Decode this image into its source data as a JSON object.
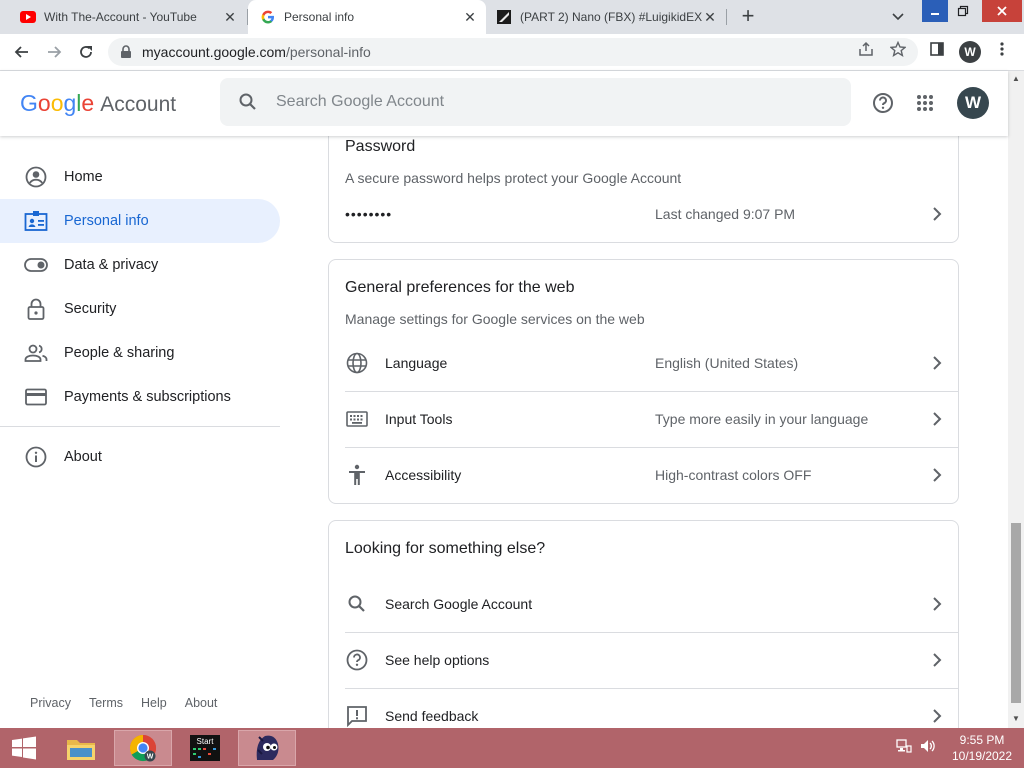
{
  "browser": {
    "tabs": [
      {
        "title": "With The-Account - YouTube",
        "active": false,
        "favicon": "youtube-icon"
      },
      {
        "title": "Personal info",
        "active": true,
        "favicon": "google-g-icon"
      },
      {
        "title": "(PART 2) Nano (FBX) #LuigikidEX",
        "active": false,
        "favicon": "deviantart-icon"
      }
    ],
    "url_host": "myaccount.google.com",
    "url_path": "/personal-info",
    "profile_initial": "W"
  },
  "header": {
    "logo_google": "Google",
    "logo_account": "Account",
    "search_placeholder": "Search Google Account",
    "avatar_initial": "W"
  },
  "sidebar": {
    "items": [
      {
        "label": "Home",
        "icon": "account-circle-icon"
      },
      {
        "label": "Personal info",
        "icon": "id-card-icon",
        "active": true
      },
      {
        "label": "Data & privacy",
        "icon": "toggle-icon"
      },
      {
        "label": "Security",
        "icon": "lock-icon"
      },
      {
        "label": "People & sharing",
        "icon": "people-icon"
      },
      {
        "label": "Payments & subscriptions",
        "icon": "credit-card-icon"
      },
      {
        "label": "About",
        "icon": "info-icon"
      }
    ],
    "footer": [
      "Privacy",
      "Terms",
      "Help",
      "About"
    ]
  },
  "password_card": {
    "title": "Password",
    "subtitle": "A secure password helps protect your Google Account",
    "masked": "••••••••",
    "last_changed": "Last changed 9:07 PM"
  },
  "prefs_card": {
    "title": "General preferences for the web",
    "subtitle": "Manage settings for Google services on the web",
    "rows": [
      {
        "label": "Language",
        "value": "English (United States)",
        "icon": "globe-icon"
      },
      {
        "label": "Input Tools",
        "value": "Type more easily in your language",
        "icon": "keyboard-icon"
      },
      {
        "label": "Accessibility",
        "value": "High-contrast colors OFF",
        "icon": "accessibility-icon"
      }
    ]
  },
  "else_card": {
    "title": "Looking for something else?",
    "rows": [
      {
        "label": "Search Google Account",
        "icon": "search-icon"
      },
      {
        "label": "See help options",
        "icon": "help-icon"
      },
      {
        "label": "Send feedback",
        "icon": "feedback-icon"
      }
    ]
  },
  "taskbar": {
    "start_label": "Start",
    "time": "9:55 PM",
    "date": "10/19/2022"
  },
  "colors": {
    "accent": "#1967d2",
    "active_nav_bg": "#e8f0fe",
    "taskbar": "#b1646a"
  }
}
